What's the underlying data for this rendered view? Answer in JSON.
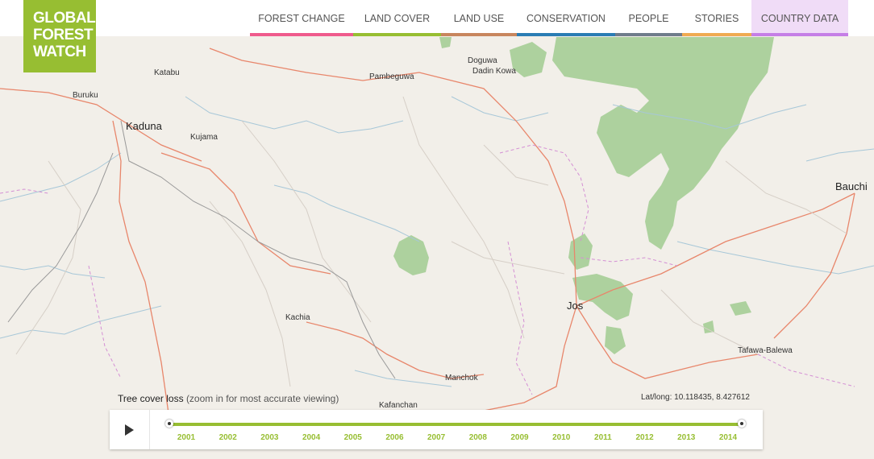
{
  "logo": {
    "line1": "GLOBAL",
    "line2": "FOREST",
    "line3": "WATCH",
    "color": "#97be32"
  },
  "nav": [
    {
      "label": "FOREST CHANGE",
      "color": "#ef5b8d"
    },
    {
      "label": "LAND COVER",
      "color": "#97be32"
    },
    {
      "label": "LAND USE",
      "color": "#c8865e"
    },
    {
      "label": "CONSERVATION",
      "color": "#2a7db4"
    },
    {
      "label": "PEOPLE",
      "color": "#707d8c"
    },
    {
      "label": "STORIES",
      "color": "#f0ab52"
    },
    {
      "label": "COUNTRY DATA",
      "color": "#c57ee6"
    }
  ],
  "places": {
    "katabu": "Katabu",
    "buruku": "Buruku",
    "kaduna": "Kaduna",
    "kujama": "Kujama",
    "pambeguwa": "Pambeguwa",
    "doguwa": "Doguwa",
    "dadin_kowa": "Dadin Kowa",
    "bauchi": "Bauchi",
    "jos": "Jos",
    "kachia": "Kachia",
    "tafawa_balewa": "Tafawa-Balewa",
    "manchok": "Manchok",
    "kafanchan": "Kafanchan"
  },
  "legend": {
    "title": "Tree cover loss",
    "subtitle": "(zoom in for most accurate viewing)"
  },
  "coords": {
    "label": "Lat/long: 10.118435, 8.427612"
  },
  "timeline": {
    "years": [
      "2001",
      "2002",
      "2003",
      "2004",
      "2005",
      "2006",
      "2007",
      "2008",
      "2009",
      "2010",
      "2011",
      "2012",
      "2013",
      "2014"
    ],
    "track_color": "#97be32"
  }
}
